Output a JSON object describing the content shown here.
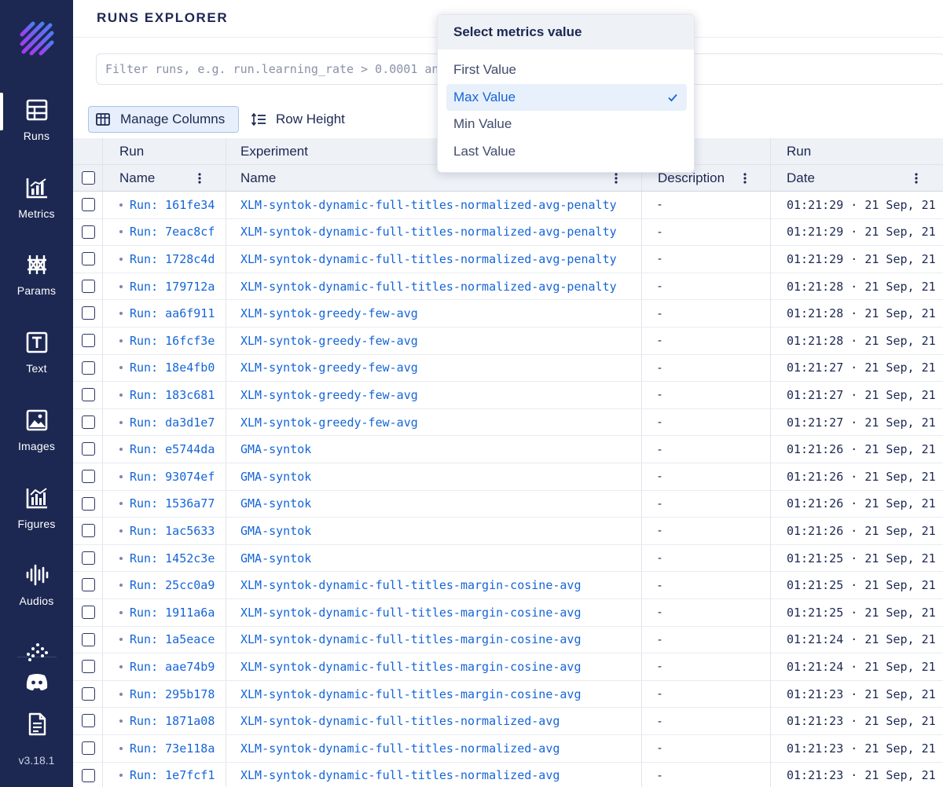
{
  "app": {
    "version": "v3.18.1"
  },
  "sidebar": {
    "items": [
      {
        "label": "Runs",
        "icon": "table-icon",
        "active": true
      },
      {
        "label": "Metrics",
        "icon": "metrics-chart-icon",
        "active": false
      },
      {
        "label": "Params",
        "icon": "params-icon",
        "active": false
      },
      {
        "label": "Text",
        "icon": "text-icon",
        "active": false
      },
      {
        "label": "Images",
        "icon": "image-icon",
        "active": false
      },
      {
        "label": "Figures",
        "icon": "figures-icon",
        "active": false
      },
      {
        "label": "Audios",
        "icon": "audio-wave-icon",
        "active": false
      }
    ],
    "bottom_icons": [
      "scatter-icon",
      "discord-icon",
      "docs-icon"
    ]
  },
  "header": {
    "title": "RUNS EXPLORER"
  },
  "filter": {
    "placeholder": "Filter runs, e.g. run.learning_rate > 0.0001 and run.batch_size == 32"
  },
  "toolbar": {
    "manage_columns_label": "Manage Columns",
    "row_height_label": "Row Height"
  },
  "table": {
    "group_headers": {
      "run": "Run",
      "experiment": "Experiment",
      "run_date": "Run"
    },
    "columns": {
      "run_name": "Name",
      "experiment_name": "Name",
      "description": "Description",
      "date": "Date"
    },
    "rows": [
      {
        "run": "Run: 161fe34",
        "experiment": "XLM-syntok-dynamic-full-titles-normalized-avg-penalty",
        "description": "-",
        "date": "01:21:29 · 21 Sep, 21"
      },
      {
        "run": "Run: 7eac8cf",
        "experiment": "XLM-syntok-dynamic-full-titles-normalized-avg-penalty",
        "description": "-",
        "date": "01:21:29 · 21 Sep, 21"
      },
      {
        "run": "Run: 1728c4d",
        "experiment": "XLM-syntok-dynamic-full-titles-normalized-avg-penalty",
        "description": "-",
        "date": "01:21:29 · 21 Sep, 21"
      },
      {
        "run": "Run: 179712a",
        "experiment": "XLM-syntok-dynamic-full-titles-normalized-avg-penalty",
        "description": "-",
        "date": "01:21:28 · 21 Sep, 21"
      },
      {
        "run": "Run: aa6f911",
        "experiment": "XLM-syntok-greedy-few-avg",
        "description": "-",
        "date": "01:21:28 · 21 Sep, 21"
      },
      {
        "run": "Run: 16fcf3e",
        "experiment": "XLM-syntok-greedy-few-avg",
        "description": "-",
        "date": "01:21:28 · 21 Sep, 21"
      },
      {
        "run": "Run: 18e4fb0",
        "experiment": "XLM-syntok-greedy-few-avg",
        "description": "-",
        "date": "01:21:27 · 21 Sep, 21"
      },
      {
        "run": "Run: 183c681",
        "experiment": "XLM-syntok-greedy-few-avg",
        "description": "-",
        "date": "01:21:27 · 21 Sep, 21"
      },
      {
        "run": "Run: da3d1e7",
        "experiment": "XLM-syntok-greedy-few-avg",
        "description": "-",
        "date": "01:21:27 · 21 Sep, 21"
      },
      {
        "run": "Run: e5744da",
        "experiment": "GMA-syntok",
        "description": "-",
        "date": "01:21:26 · 21 Sep, 21"
      },
      {
        "run": "Run: 93074ef",
        "experiment": "GMA-syntok",
        "description": "-",
        "date": "01:21:26 · 21 Sep, 21"
      },
      {
        "run": "Run: 1536a77",
        "experiment": "GMA-syntok",
        "description": "-",
        "date": "01:21:26 · 21 Sep, 21"
      },
      {
        "run": "Run: 1ac5633",
        "experiment": "GMA-syntok",
        "description": "-",
        "date": "01:21:26 · 21 Sep, 21"
      },
      {
        "run": "Run: 1452c3e",
        "experiment": "GMA-syntok",
        "description": "-",
        "date": "01:21:25 · 21 Sep, 21"
      },
      {
        "run": "Run: 25cc0a9",
        "experiment": "XLM-syntok-dynamic-full-titles-margin-cosine-avg",
        "description": "-",
        "date": "01:21:25 · 21 Sep, 21"
      },
      {
        "run": "Run: 1911a6a",
        "experiment": "XLM-syntok-dynamic-full-titles-margin-cosine-avg",
        "description": "-",
        "date": "01:21:25 · 21 Sep, 21"
      },
      {
        "run": "Run: 1a5eace",
        "experiment": "XLM-syntok-dynamic-full-titles-margin-cosine-avg",
        "description": "-",
        "date": "01:21:24 · 21 Sep, 21"
      },
      {
        "run": "Run: aae74b9",
        "experiment": "XLM-syntok-dynamic-full-titles-margin-cosine-avg",
        "description": "-",
        "date": "01:21:24 · 21 Sep, 21"
      },
      {
        "run": "Run: 295b178",
        "experiment": "XLM-syntok-dynamic-full-titles-margin-cosine-avg",
        "description": "-",
        "date": "01:21:23 · 21 Sep, 21"
      },
      {
        "run": "Run: 1871a08",
        "experiment": "XLM-syntok-dynamic-full-titles-normalized-avg",
        "description": "-",
        "date": "01:21:23 · 21 Sep, 21"
      },
      {
        "run": "Run: 73e118a",
        "experiment": "XLM-syntok-dynamic-full-titles-normalized-avg",
        "description": "-",
        "date": "01:21:23 · 21 Sep, 21"
      },
      {
        "run": "Run: 1e7fcf1",
        "experiment": "XLM-syntok-dynamic-full-titles-normalized-avg",
        "description": "-",
        "date": "01:21:23 · 21 Sep, 21"
      }
    ]
  },
  "metrics_dropdown": {
    "title": "Select metrics value",
    "options": [
      "First Value",
      "Max Value",
      "Min Value",
      "Last Value"
    ],
    "selected": "Max Value"
  },
  "colors": {
    "sidebar_bg": "#1c2852",
    "link": "#1565d8",
    "header_bg": "#eef1f6",
    "selected_bg": "#e8f0fb"
  }
}
